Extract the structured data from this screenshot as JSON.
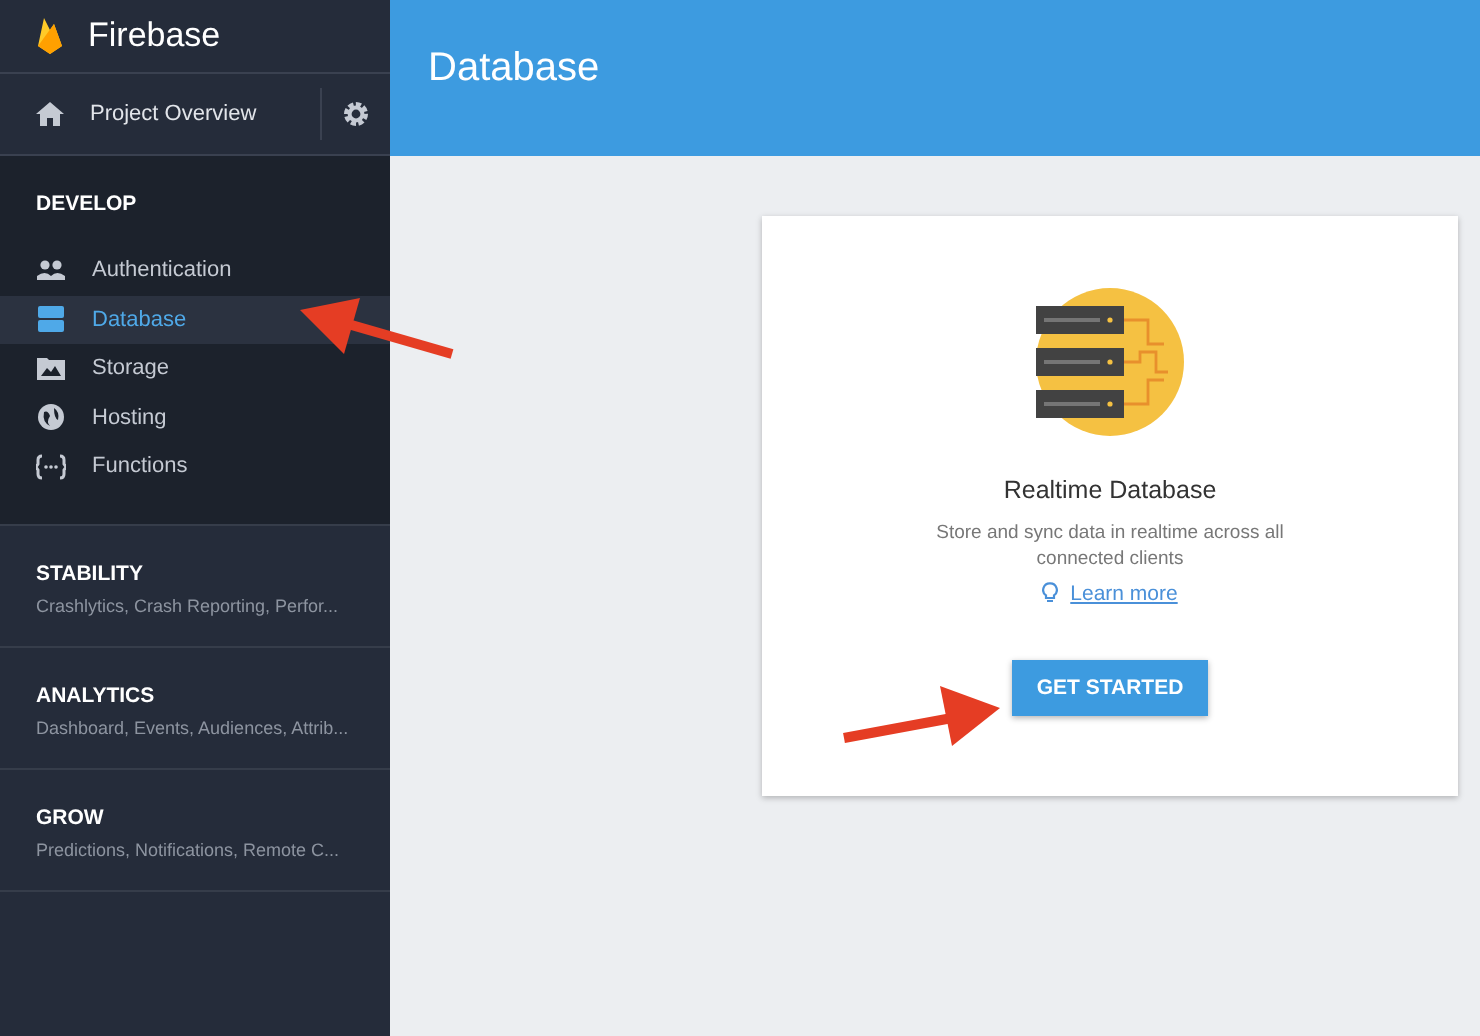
{
  "brand": "Firebase",
  "project_overview": "Project Overview",
  "develop": {
    "heading": "DEVELOP",
    "items": [
      {
        "label": "Authentication",
        "selected": false
      },
      {
        "label": "Database",
        "selected": true
      },
      {
        "label": "Storage",
        "selected": false
      },
      {
        "label": "Hosting",
        "selected": false
      },
      {
        "label": "Functions",
        "selected": false
      }
    ]
  },
  "sections": [
    {
      "heading": "STABILITY",
      "summary": "Crashlytics, Crash Reporting, Perfor..."
    },
    {
      "heading": "ANALYTICS",
      "summary": "Dashboard, Events, Audiences, Attrib..."
    },
    {
      "heading": "GROW",
      "summary": "Predictions, Notifications, Remote C..."
    }
  ],
  "page_title": "Database",
  "card": {
    "title": "Realtime Database",
    "description": "Store and sync data in realtime across all connected clients",
    "link": "Learn more",
    "button": "GET STARTED"
  }
}
